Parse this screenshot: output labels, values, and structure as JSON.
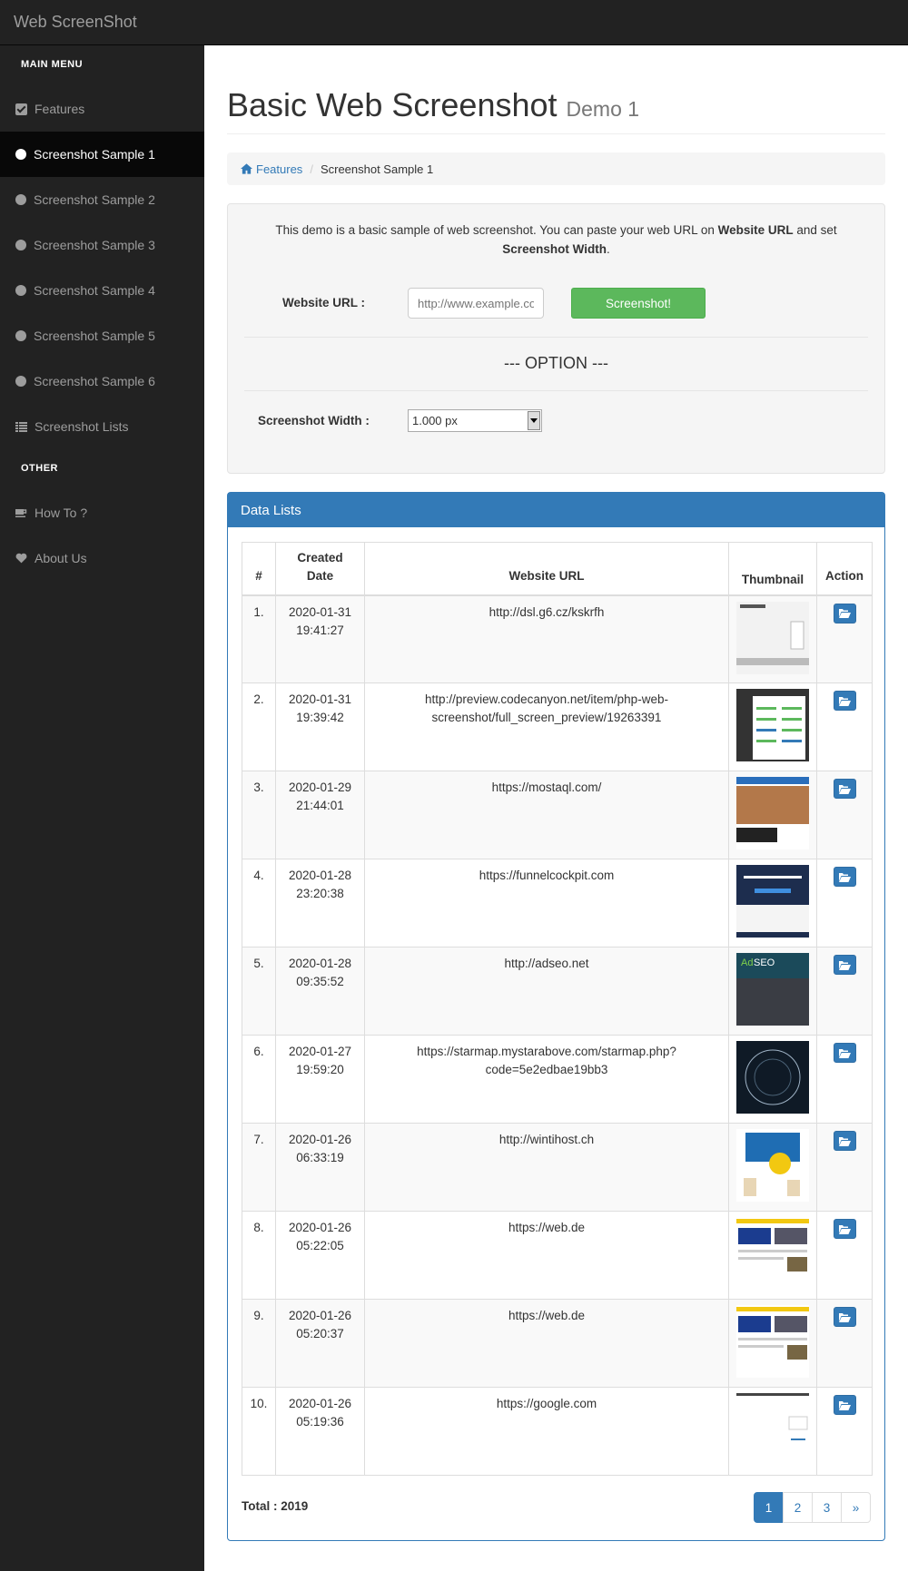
{
  "app": {
    "title": "Web ScreenShot"
  },
  "sidebar": {
    "main_menu_heading": "MAIN MENU",
    "other_heading": "OTHER",
    "items": [
      {
        "label": "Features",
        "icon": "check-square-icon"
      },
      {
        "label": "Screenshot Sample 1",
        "icon": "circle-icon",
        "active": true
      },
      {
        "label": "Screenshot Sample 2",
        "icon": "circle-icon"
      },
      {
        "label": "Screenshot Sample 3",
        "icon": "circle-icon"
      },
      {
        "label": "Screenshot Sample 4",
        "icon": "circle-icon"
      },
      {
        "label": "Screenshot Sample 5",
        "icon": "circle-icon"
      },
      {
        "label": "Screenshot Sample 6",
        "icon": "circle-icon"
      },
      {
        "label": "Screenshot Lists",
        "icon": "list-icon"
      }
    ],
    "other_items": [
      {
        "label": "How To ?",
        "icon": "coffee-icon"
      },
      {
        "label": "About Us",
        "icon": "heart-icon"
      }
    ]
  },
  "page": {
    "title": "Basic Web Screenshot",
    "subtitle": "Demo 1"
  },
  "breadcrumb": {
    "home": "Features",
    "current": "Screenshot Sample 1",
    "separator": "/"
  },
  "form": {
    "intro_1": "This demo is a basic sample of web screenshot. You can paste your web URL on ",
    "intro_bold_1": "Website URL",
    "intro_2": " and set ",
    "intro_bold_2": "Screenshot Width",
    "intro_3": ".",
    "url_label": "Website URL :",
    "url_placeholder": "http://www.example.com",
    "submit_label": "Screenshot!",
    "option_heading": "--- OPTION ---",
    "width_label": "Screenshot Width :",
    "width_value": "1.000 px"
  },
  "panel": {
    "title": "Data Lists"
  },
  "table": {
    "headers": {
      "no": "#",
      "date": "Created Date",
      "url": "Website URL",
      "thumb": "Thumbnail",
      "action": "Action"
    },
    "rows": [
      {
        "no": "1.",
        "date": "2020-01-31",
        "time": "19:41:27",
        "url": "http://dsl.g6.cz/kskrfh"
      },
      {
        "no": "2.",
        "date": "2020-01-31",
        "time": "19:39:42",
        "url": "http://preview.codecanyon.net/item/php-web-screenshot/full_screen_preview/19263391"
      },
      {
        "no": "3.",
        "date": "2020-01-29",
        "time": "21:44:01",
        "url": "https://mostaql.com/"
      },
      {
        "no": "4.",
        "date": "2020-01-28",
        "time": "23:20:38",
        "url": "https://funnelcockpit.com"
      },
      {
        "no": "5.",
        "date": "2020-01-28",
        "time": "09:35:52",
        "url": "http://adseo.net"
      },
      {
        "no": "6.",
        "date": "2020-01-27",
        "time": "19:59:20",
        "url": "https://starmap.mystarabove.com/starmap.php?code=5e2edbae19bb3"
      },
      {
        "no": "7.",
        "date": "2020-01-26",
        "time": "06:33:19",
        "url": "http://wintihost.ch"
      },
      {
        "no": "8.",
        "date": "2020-01-26",
        "time": "05:22:05",
        "url": "https://web.de"
      },
      {
        "no": "9.",
        "date": "2020-01-26",
        "time": "05:20:37",
        "url": "https://web.de"
      },
      {
        "no": "10.",
        "date": "2020-01-26",
        "time": "05:19:36",
        "url": "https://google.com"
      }
    ]
  },
  "total": {
    "label": "Total : 2019"
  },
  "pagination": {
    "pages": [
      "1",
      "2",
      "3"
    ],
    "next": "»",
    "current": "1"
  },
  "colors": {
    "primary": "#337ab7",
    "success": "#5cb85c",
    "sidebar": "#222222"
  }
}
